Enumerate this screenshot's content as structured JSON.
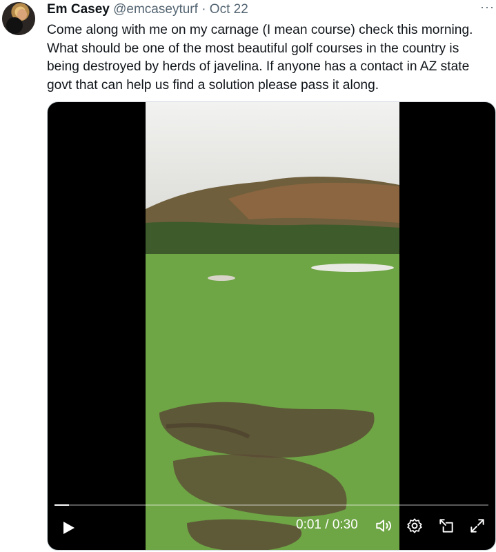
{
  "tweet": {
    "author_name": "Em Casey",
    "handle": "@emcaseyturf",
    "separator": "·",
    "date": "Oct 22",
    "more_label": "···",
    "text": "Come along with me on my carnage (I mean course) check this morning. What should be one of the most beautiful golf courses in the country is being destroyed by herds of javelina. If anyone has a contact in AZ state govt that can help us find a solution please pass it along."
  },
  "video": {
    "time_display": "0:01 / 0:30",
    "progress": 0.033,
    "icons": [
      "play-icon",
      "volume-icon",
      "settings-icon",
      "pop-out-icon",
      "fullscreen-icon"
    ]
  },
  "colors": {
    "text": "#0f1419",
    "secondary": "#536471",
    "media_bg": "#000000"
  }
}
